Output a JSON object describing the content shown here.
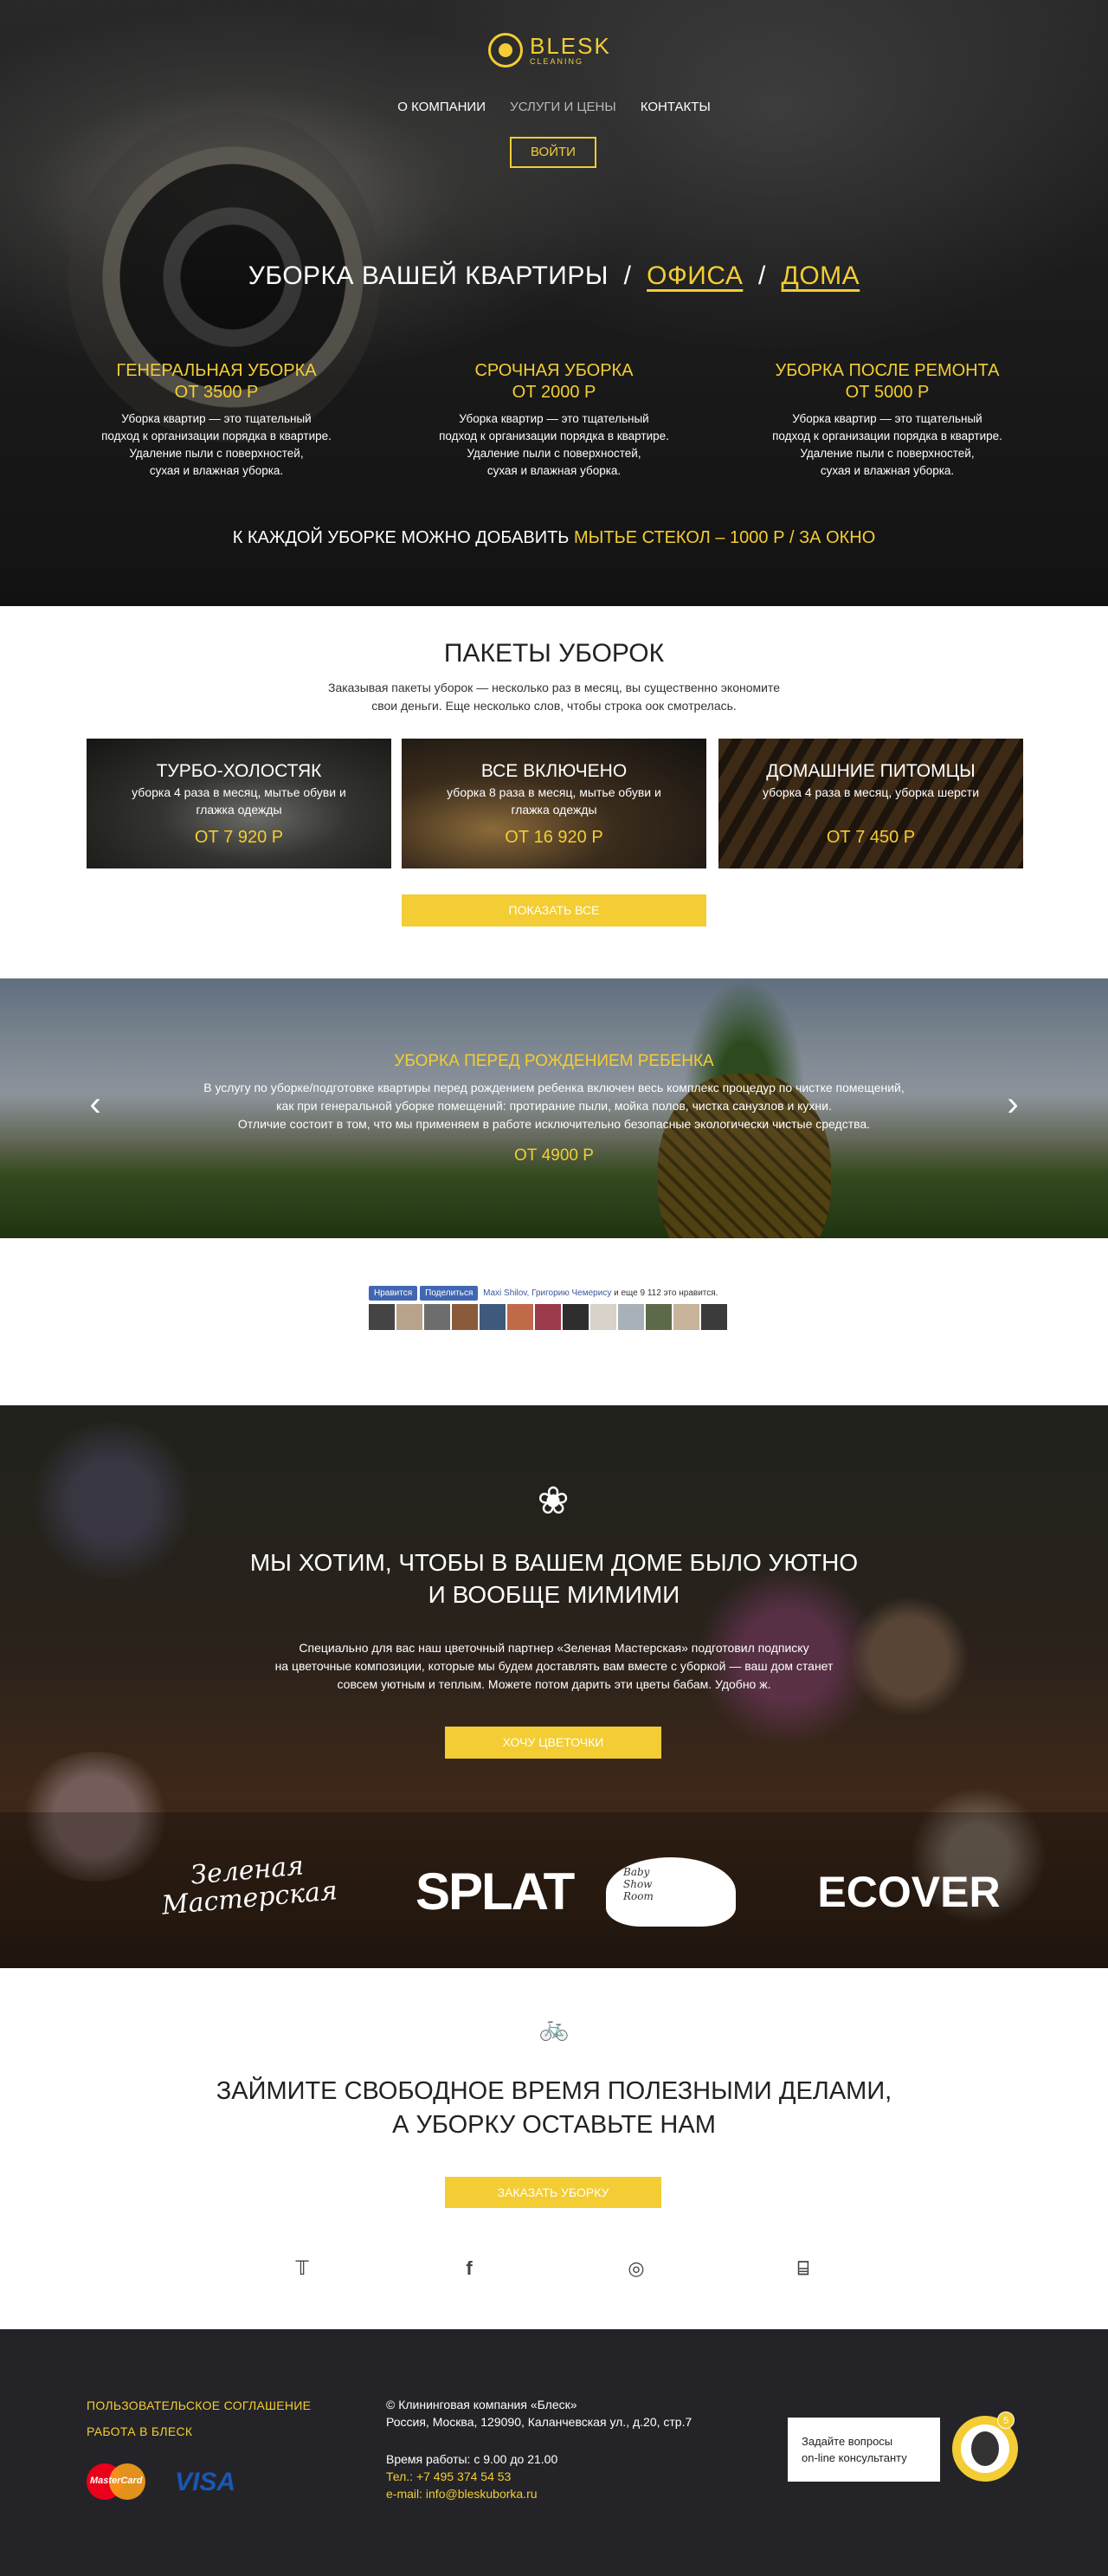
{
  "logo": {
    "name": "BLESK",
    "sub": "CLEANING"
  },
  "nav": {
    "about": "О КОМПАНИИ",
    "services": "УСЛУГИ И ЦЕНЫ",
    "contacts": "КОНТАКТЫ",
    "login": "ВОЙТИ"
  },
  "hero": {
    "title_prefix": "УБОРКА ВАШЕЙ КВАРТИРЫ",
    "sep1": "/",
    "office": "ОФИСА",
    "sep2": "/",
    "home": "ДОМА",
    "columns": [
      {
        "title": "ГЕНЕРАЛЬНАЯ УБОРКА",
        "price": "ОТ 3500 Р",
        "desc": [
          "Уборка квартир — это тщательный",
          "подход к организации порядка в квартире.",
          "Удаление пыли с поверхностей,",
          "сухая и влажная уборка."
        ]
      },
      {
        "title": "СРОЧНАЯ УБОРКА",
        "price": "ОТ 2000 Р",
        "desc": [
          "Уборка квартир — это тщательный",
          "подход к организации порядка в квартире.",
          "Удаление пыли с поверхностей,",
          "сухая и влажная уборка."
        ]
      },
      {
        "title": "УБОРКА ПОСЛЕ РЕМОНТА",
        "price": "ОТ 5000 Р",
        "desc": [
          "Уборка квартир — это тщательный",
          "подход к организации порядка в квартире.",
          "Удаление пыли с поверхностей,",
          "сухая и влажная уборка."
        ]
      }
    ],
    "note_prefix": "К КАЖДОЙ УБОРКЕ МОЖНО ДОБАВИТЬ",
    "note_highlight": "МЫТЬЕ СТЕКОЛ – 1000 Р / ЗА ОКНО"
  },
  "packages": {
    "title": "ПАКЕТЫ УБОРОК",
    "subtitle": [
      "Заказывая пакеты уборок — несколько раз в месяц, вы существенно экономите",
      "свои деньги. Еще несколько слов, чтобы строка оок смотрелась."
    ],
    "cards": [
      {
        "title": "ТУРБО-ХОЛОСТЯК",
        "desc": "уборка 4 раза в месяц, мытье обуви и глажка одежды",
        "price": "ОТ 7 920 Р"
      },
      {
        "title": "ВСЕ ВКЛЮЧЕНО",
        "desc": "уборка 8 раза в месяц, мытье обуви и глажка одежды",
        "price": "ОТ 16 920 Р"
      },
      {
        "title": "ДОМАШНИЕ ПИТОМЦЫ",
        "desc": "уборка 4 раза в месяц, уборка шерсти",
        "price": "ОТ 7 450 Р"
      }
    ],
    "show_all": "ПОКАЗАТЬ ВСЕ"
  },
  "slider": {
    "title": "УБОРКА ПЕРЕД РОЖДЕНИЕМ РЕБЕНКА",
    "text": [
      "В услугу по уборке/подготовке квартиры перед рождением ребенка включен весь комплекс процедур по чистке помещений,",
      "как при генеральной уборке помещений: протирание пыли, мойка полов, чистка санузлов и кухни.",
      "Отличие состоит в том, что мы применяем в работе исключительно безопасные экологически чистые средства."
    ],
    "price": "ОТ 4900 Р",
    "prev": "‹",
    "next": "›"
  },
  "facebook": {
    "like": "Нравится",
    "share": "Поделиться",
    "names": "Maxi Shilov, Григорию Чемерису",
    "rest": "и еще 9 112 это нравится.",
    "avatar_colors": [
      "#444",
      "#b8a28c",
      "#6d6d6d",
      "#8a5a3c",
      "#3e5a7c",
      "#c06a4a",
      "#9a3a4a",
      "#2e2e2e",
      "#d8d2c8",
      "#a9b1b8",
      "#5c6a4a",
      "#c8b49a",
      "#3b3b3b"
    ]
  },
  "flowers": {
    "icon": "❀",
    "title": [
      "МЫ ХОТИМ, ЧТОБЫ В ВАШЕМ ДОМЕ БЫЛО УЮТНО",
      "И ВООБЩЕ МИМИМИ"
    ],
    "text": [
      "Специально для вас наш цветочный партнер «Зеленая Мастерская» подготовил подписку",
      "на цветочные композиции, которые мы будем доставлять вам вместе с уборкой —  ваш дом станет",
      "совсем уютным и теплым. Можете потом дарить эти цветы бабам. Удобно ж."
    ],
    "button": "ХОЧУ ЦВЕТОЧКИ",
    "partners": {
      "p1": [
        "Зеленая",
        "Мастерская"
      ],
      "p2": "SPLAT",
      "p3": [
        "Baby",
        "Show",
        "Room"
      ],
      "p4": "ECOVER"
    }
  },
  "cta": {
    "icon": "🚲",
    "title": [
      "ЗАЙМИТЕ СВОБОДНОЕ ВРЕМЯ ПОЛЕЗНЫМИ ДЕЛАМИ,",
      "А УБОРКУ ОСТАВЬТЕ НАМ"
    ],
    "button": "ЗАКАЗАТЬ УБОРКУ",
    "social": {
      "twitter": "𝕋",
      "facebook": "f",
      "dribbble": "◎",
      "instagram": "⌸"
    }
  },
  "footer": {
    "agreement": "ПОЛЬЗОВАТЕЛЬСКОЕ СОГЛАШЕНИЕ",
    "jobs": "РАБОТА В БЛЕСК",
    "mastercard": "MasterCard",
    "visa": "VISA",
    "company": "© Клининговая компания «Блеск»",
    "address": "Россия, Москва, 129090, Каланчевская ул., д.20, стр.7",
    "hours": "Время работы: с 9.00 до 21.00",
    "phone_label": "Тел.:",
    "phone": "+7 495 374 54 53",
    "email_label": "e-mail:",
    "email": "info@bleskuborka.ru",
    "chat": [
      "Задайте вопросы",
      "on-line консультанту"
    ],
    "chat_badge": "5"
  }
}
